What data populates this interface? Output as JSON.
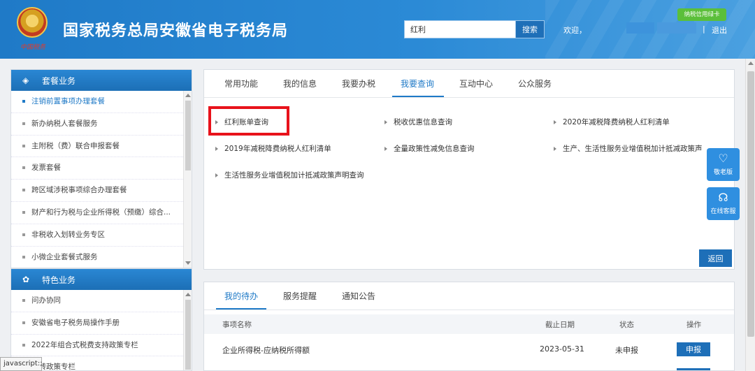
{
  "header": {
    "site_title": "国家税务总局安徽省电子税务局",
    "credit_badge": "纳税信用绿卡",
    "search_value": "红利",
    "search_button": "搜索",
    "welcome": "欢迎，",
    "separator": "|",
    "logout": "退出"
  },
  "sidebar": {
    "section1_title": "套餐业务",
    "section1_items": [
      "注销前置事项办理套餐",
      "新办纳税人套餐服务",
      "主附税（费）联合申报套餐",
      "发票套餐",
      "跨区域涉税事项综合办理套餐",
      "财产和行为税与企业所得税（预缴）综合...",
      "非税收入划转业务专区",
      "小微企业套餐式服务"
    ],
    "section2_title": "特色业务",
    "section2_items": [
      "问办协同",
      "安徽省电子税务局操作手册",
      "2022年组合式税费支持政策专栏",
      "划转政策专栏"
    ]
  },
  "main_tabs": [
    "常用功能",
    "我的信息",
    "我要办税",
    "我要查询",
    "互动中心",
    "公众服务"
  ],
  "query_items": [
    "红利账单查询",
    "税收优惠信息查询",
    "2020年减税降费纳税人红利清单",
    "2019年减税降费纳税人红利清单",
    "全量政策性减免信息查询",
    "生产、生活性服务业增值税加计抵减政策声",
    "生活性服务业增值税加计抵减政策声明查询"
  ],
  "back_button": "返回",
  "float_widgets": {
    "elder": "敬老版",
    "service": "在线客服"
  },
  "todo": {
    "tabs": [
      "我的待办",
      "服务提醒",
      "通知公告"
    ],
    "columns": [
      "事项名称",
      "截止日期",
      "状态",
      "操作"
    ],
    "rows": [
      {
        "name": "企业所得税-应纳税所得额",
        "deadline": "2023-05-31",
        "status": "未申报",
        "action": "申报"
      }
    ]
  },
  "status_tip": "javascript:;"
}
